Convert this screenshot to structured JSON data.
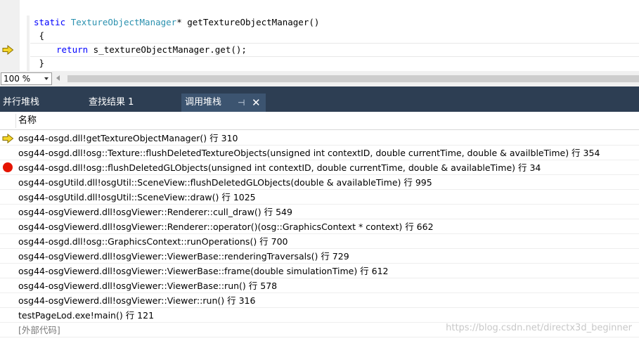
{
  "editor": {
    "lines": [
      {
        "keyword": "static",
        "type": "TextureObjectManager",
        "rest": "* getTextureObjectManager()"
      },
      {
        "text": " {"
      },
      {
        "keyword": "return",
        "rest": " s_textureObjectManager.get();"
      },
      {
        "text": " }"
      }
    ]
  },
  "zoom": {
    "value": "100 %"
  },
  "tabs": [
    {
      "label": "并行堆栈"
    },
    {
      "label": "查找结果 1"
    },
    {
      "label": "调用堆栈",
      "pin": "⊣",
      "close": "✕"
    }
  ],
  "callstack": {
    "column_header": "名称",
    "rows": [
      {
        "text": "osg44-osgd.dll!getTextureObjectManager() 行 310",
        "marker": "current"
      },
      {
        "text": "osg44-osgd.dll!osg::Texture::flushDeletedTextureObjects(unsigned int contextID, double currentTime, double & availbleTime) 行 354",
        "marker": ""
      },
      {
        "text": "osg44-osgd.dll!osg::flushDeletedGLObjects(unsigned int contextID, double currentTime, double & availableTime) 行 34",
        "marker": "breakpoint"
      },
      {
        "text": "osg44-osgUtild.dll!osgUtil::SceneView::flushDeletedGLObjects(double & availableTime) 行 995",
        "marker": ""
      },
      {
        "text": "osg44-osgUtild.dll!osgUtil::SceneView::draw() 行 1025",
        "marker": ""
      },
      {
        "text": "osg44-osgViewerd.dll!osgViewer::Renderer::cull_draw() 行 549",
        "marker": ""
      },
      {
        "text": "osg44-osgViewerd.dll!osgViewer::Renderer::operator()(osg::GraphicsContext * context) 行 662",
        "marker": ""
      },
      {
        "text": "osg44-osgd.dll!osg::GraphicsContext::runOperations() 行 700",
        "marker": ""
      },
      {
        "text": "osg44-osgViewerd.dll!osgViewer::ViewerBase::renderingTraversals() 行 729",
        "marker": ""
      },
      {
        "text": "osg44-osgViewerd.dll!osgViewer::ViewerBase::frame(double simulationTime) 行 612",
        "marker": ""
      },
      {
        "text": "osg44-osgViewerd.dll!osgViewer::ViewerBase::run() 行 578",
        "marker": ""
      },
      {
        "text": "osg44-osgViewerd.dll!osgViewer::Viewer::run() 行 316",
        "marker": ""
      },
      {
        "text": "testPageLod.exe!main() 行 121",
        "marker": ""
      },
      {
        "text": "[外部代码]",
        "marker": "external"
      }
    ]
  },
  "watermark": "https://blog.csdn.net/directx3d_beginner",
  "colors": {
    "tab_strip": "#2d3e53",
    "active_tab": "#3c5470",
    "breakpoint": "#e51400",
    "exec_arrow": "#f5d629",
    "keyword": "#0000ff",
    "type": "#2b91af"
  }
}
